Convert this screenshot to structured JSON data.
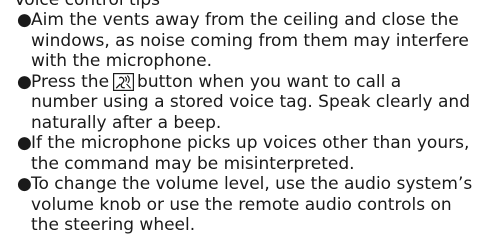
{
  "section": {
    "heading": "Voice control tips"
  },
  "tips": [
    {
      "lines": [
        "Aim the vents away from the ceiling and close the",
        "windows, as noise coming from them may interfere",
        "with the microphone."
      ]
    },
    {
      "line1_before_icon": "Press the",
      "icon": "talk-button-icon",
      "line1_after_icon": "button when you want to call a",
      "lines": [
        "number using a stored voice tag. Speak clearly and",
        "naturally after a beep."
      ]
    },
    {
      "lines": [
        "If the microphone picks up voices other than yours,",
        "the command may be misinterpreted."
      ]
    },
    {
      "lines": [
        "To change the volume level, use the audio system’s",
        "volume knob or use the remote audio controls on",
        "the steering wheel."
      ]
    }
  ],
  "bullet_symbol": "●"
}
